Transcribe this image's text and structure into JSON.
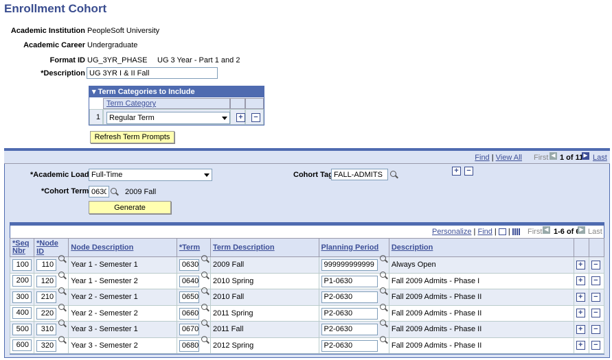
{
  "page": {
    "title": "Enrollment Cohort"
  },
  "fields": {
    "institution_label": "Academic Institution",
    "institution_value": "PeopleSoft University",
    "career_label": "Academic Career",
    "career_value": "Undergraduate",
    "format_label": "Format ID",
    "format_value": "UG_3YR_PHASE",
    "format_desc": "UG 3 Year - Part 1 and 2",
    "description_label": "*Description",
    "description_value": "UG 3YR I & II Fall"
  },
  "term_categories": {
    "header": "Term Categories to Include",
    "col": "Term Category",
    "row_num": "1",
    "value": "Regular Term"
  },
  "refresh_button": "Refresh Term Prompts",
  "scroll_nav": {
    "find": "Find",
    "view_all": "View All",
    "first": "First",
    "count": "1 of 11",
    "last": "Last"
  },
  "cohort": {
    "load_label": "*Academic Load",
    "load_value": "Full-Time",
    "tag_label": "Cohort Tag",
    "tag_value": "FALL-ADMITS",
    "term_label": "*Cohort Term",
    "term_value": "0630",
    "term_desc": "2009 Fall",
    "generate": "Generate"
  },
  "grid_nav": {
    "personalize": "Personalize",
    "find": "Find",
    "first": "First",
    "count": "1-6 of 6",
    "last": "Last"
  },
  "grid_headers": [
    "*Seq Nbr",
    "*Node ID",
    "Node Description",
    "*Term",
    "Term Description",
    "Planning Period",
    "Description"
  ],
  "rows": [
    {
      "seq": "100",
      "node": "110",
      "node_desc": "Year 1 - Semester 1",
      "term": "0630",
      "term_desc": "2009 Fall",
      "period": "999999999999",
      "desc": "Always Open"
    },
    {
      "seq": "200",
      "node": "120",
      "node_desc": "Year 1 - Semester 2",
      "term": "0640",
      "term_desc": "2010 Spring",
      "period": "P1-0630",
      "desc": "Fall 2009 Admits - Phase I"
    },
    {
      "seq": "300",
      "node": "210",
      "node_desc": "Year 2 - Semester 1",
      "term": "0650",
      "term_desc": "2010 Fall",
      "period": "P2-0630",
      "desc": "Fall 2009 Admits - Phase II"
    },
    {
      "seq": "400",
      "node": "220",
      "node_desc": "Year 2 - Semester 2",
      "term": "0660",
      "term_desc": "2011 Spring",
      "period": "P2-0630",
      "desc": "Fall 2009 Admits - Phase II"
    },
    {
      "seq": "500",
      "node": "310",
      "node_desc": "Year 3 - Semester 1",
      "term": "0670",
      "term_desc": "2011 Fall",
      "period": "P2-0630",
      "desc": "Fall 2009 Admits - Phase II"
    },
    {
      "seq": "600",
      "node": "320",
      "node_desc": "Year 3 - Semester 2",
      "term": "0680",
      "term_desc": "2012 Spring",
      "period": "P2-0630",
      "desc": "Fall 2009 Admits - Phase II"
    }
  ]
}
